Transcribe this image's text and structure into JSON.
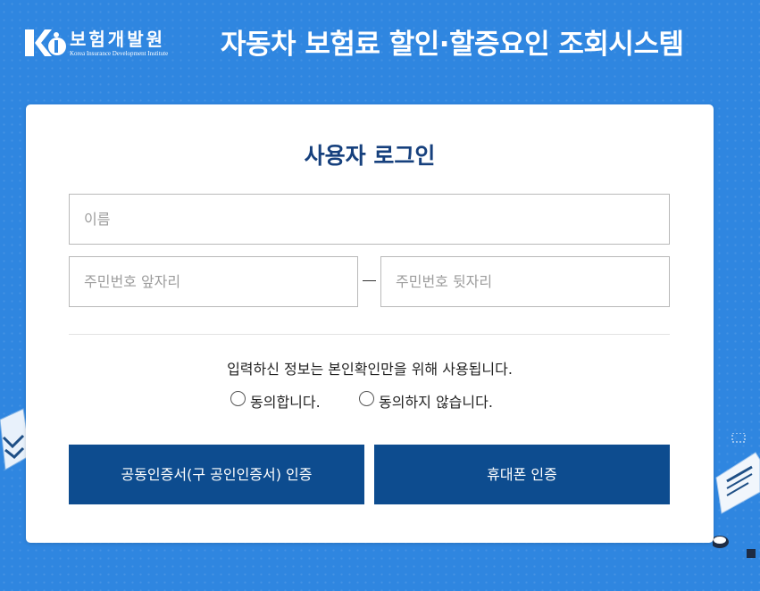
{
  "header": {
    "logo_text": "보험개발원",
    "logo_sub": "Korea Insurance Development Institute",
    "title": "자동차 보험료 할인·할증요인 조회시스템"
  },
  "login": {
    "title": "사용자 로그인",
    "name_placeholder": "이름",
    "rrn_front_placeholder": "주민번호 앞자리",
    "rrn_back_placeholder": "주민번호 뒷자리",
    "notice": "입력하신 정보는 본인확인만을 위해 사용됩니다.",
    "agree_label": "동의합니다.",
    "disagree_label": "동의하지 않습니다.",
    "cert_button": "공동인증서(구 공인인증서) 인증",
    "phone_button": "휴대폰 인증"
  },
  "colors": {
    "background": "#2f86e0",
    "button": "#0d4c8f",
    "title": "#16407d"
  }
}
